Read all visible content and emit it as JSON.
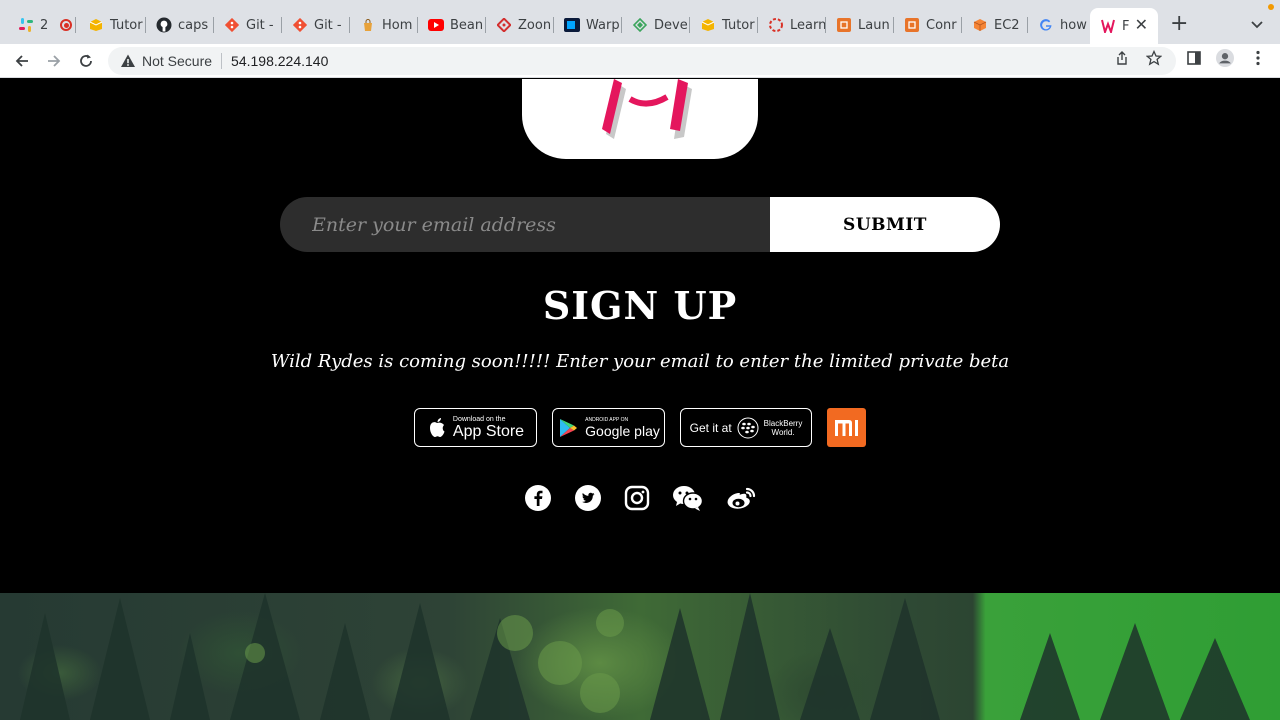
{
  "browser": {
    "tabs": [
      {
        "title": "2",
        "icon": "slack-icon",
        "color": "#e01e5a"
      },
      {
        "title": "Tutor",
        "icon": "box-icon",
        "color": "#f4b400"
      },
      {
        "title": "caps",
        "icon": "github-icon",
        "color": "#24292e"
      },
      {
        "title": "Git -",
        "icon": "git-icon",
        "color": "#f05033"
      },
      {
        "title": "Git -",
        "icon": "git-icon",
        "color": "#f05033"
      },
      {
        "title": "Hom",
        "icon": "bag-icon",
        "color": "#e8a23a"
      },
      {
        "title": "Bean",
        "icon": "youtube-icon",
        "color": "#ff0000"
      },
      {
        "title": "Zoon",
        "icon": "diamond-icon",
        "color": "#d32f2f"
      },
      {
        "title": "Warp",
        "icon": "warp-icon",
        "color": "#01a4ff"
      },
      {
        "title": "Deve",
        "icon": "dev-icon",
        "color": "#3ba55d"
      },
      {
        "title": "Tutor",
        "icon": "box-icon",
        "color": "#f4b400"
      },
      {
        "title": "Learn",
        "icon": "ring-icon",
        "color": "#d93025"
      },
      {
        "title": "Laun",
        "icon": "aws-icon",
        "color": "#e8742a"
      },
      {
        "title": "Conr",
        "icon": "aws-icon",
        "color": "#e8742a"
      },
      {
        "title": "EC2",
        "icon": "cube-icon",
        "color": "#f58536"
      },
      {
        "title": "how",
        "icon": "google-icon",
        "color": "#4285f4"
      },
      {
        "title": "F",
        "icon": "wildrydes-icon",
        "color": "#e4165d",
        "active": true
      }
    ],
    "security_label": "Not Secure",
    "url": "54.198.224.140"
  },
  "page": {
    "form": {
      "email_placeholder": "Enter your email address",
      "submit_label": "SUBMIT"
    },
    "heading": "SIGN UP",
    "subtitle": "Wild Rydes is coming soon!!!!! Enter your email to enter the limited private beta",
    "app_badges": {
      "appstore_small": "Download on the",
      "appstore_big": "App Store",
      "googleplay_small": "ANDROID APP ON",
      "googleplay_big": "Google play",
      "blackberry_prefix": "Get it at",
      "blackberry_name_1": "BlackBerry",
      "blackberry_name_2": "World.",
      "xiaomi": "mi"
    },
    "social_icons": [
      "facebook-icon",
      "twitter-icon",
      "instagram-icon",
      "wechat-icon",
      "weibo-icon"
    ]
  },
  "colors": {
    "brand_pink": "#e4165d",
    "page_bg": "#000000",
    "input_bg": "#2d2d2d",
    "xiaomi_orange": "#f26a21"
  }
}
